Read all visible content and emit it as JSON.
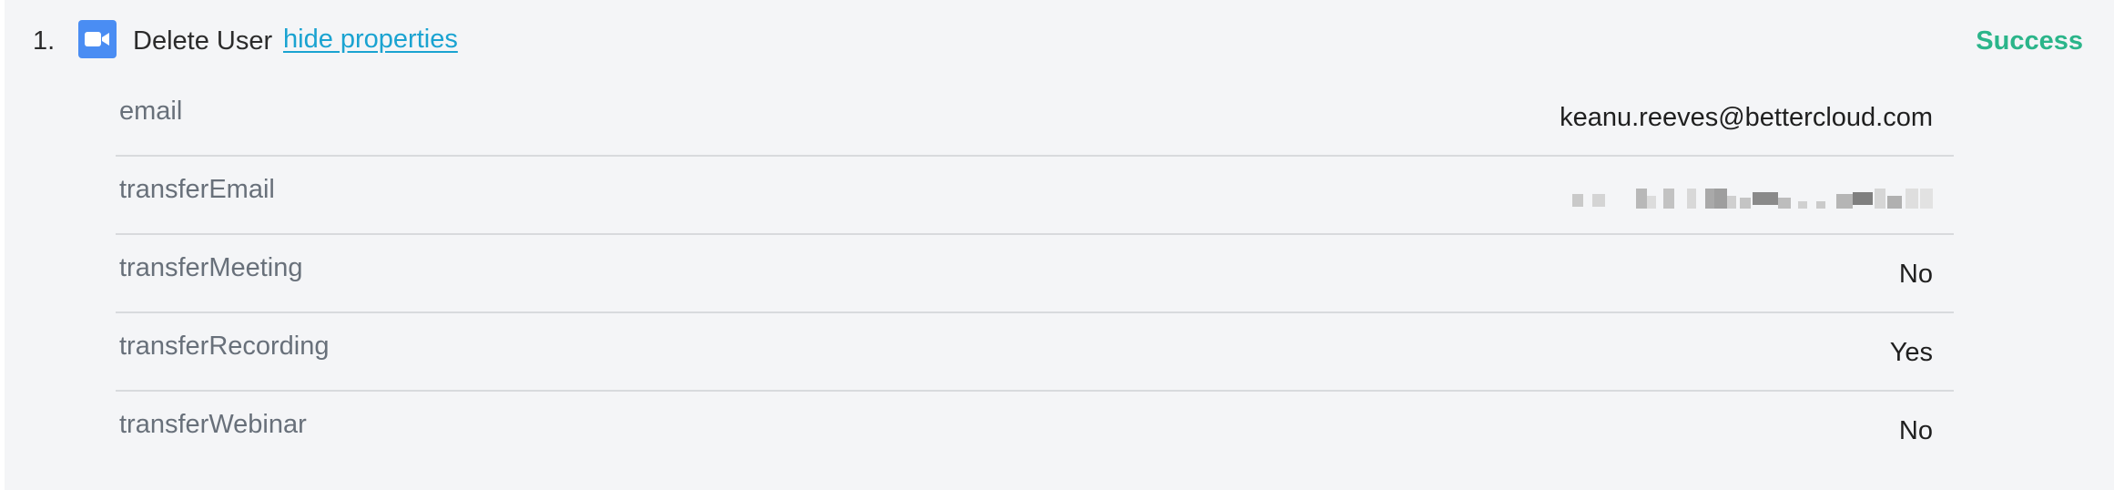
{
  "step": {
    "number": "1.",
    "app_icon": "video-camera-icon",
    "action": "Delete User",
    "toggle_label": "hide properties",
    "status": "Success",
    "status_color": "#2bb58a"
  },
  "properties": [
    {
      "key": "email",
      "value": "keanu.reeves@bettercloud.com",
      "redacted": false
    },
    {
      "key": "transferEmail",
      "value": "",
      "redacted": true
    },
    {
      "key": "transferMeeting",
      "value": "No",
      "redacted": false
    },
    {
      "key": "transferRecording",
      "value": "Yes",
      "redacted": false
    },
    {
      "key": "transferWebinar",
      "value": "No",
      "redacted": false
    }
  ]
}
